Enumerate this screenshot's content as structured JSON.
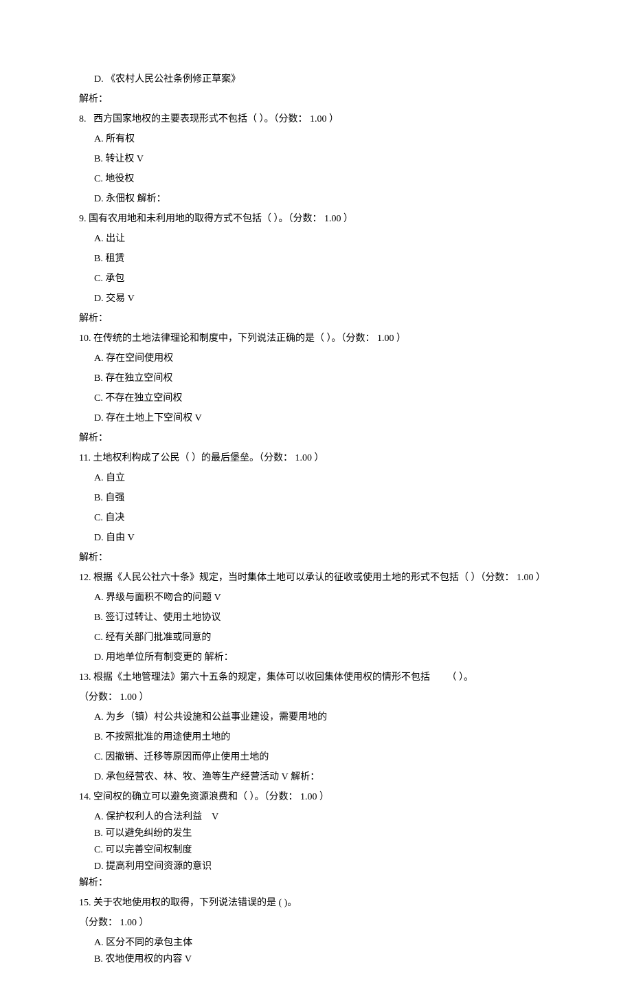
{
  "q7": {
    "d_letter": "D.",
    "d_text": "《农村人民公社条例修正草案》",
    "jx": "解析："
  },
  "q8": {
    "num": "8.",
    "stem": "西方国家地权的主要表现形式不包括（ ）。（分数： 1.00 ）",
    "a_letter": "A.",
    "a_text": "所有权",
    "b_letter": "B.",
    "b_text": "转让权",
    "b_mark": "V",
    "c_letter": "C.",
    "c_text": "地役权",
    "d_letter": "D.",
    "d_text": "永佃权 解析："
  },
  "q9": {
    "num": "9.",
    "stem": "国有农用地和未利用地的取得方式不包括（ ）。（分数： 1.00 ）",
    "a_letter": "A.",
    "a_text": "出让",
    "b_letter": "B.",
    "b_text": "租赁",
    "c_letter": "C.",
    "c_text": "承包",
    "d_letter": "D.",
    "d_text": "交易",
    "d_mark": "V",
    "jx": "解析："
  },
  "q10": {
    "num": "10.",
    "stem": "在传统的土地法律理论和制度中，下列说法正确的是（ ）。（分数： 1.00 ）",
    "a_letter": "A.",
    "a_text": "存在空间使用权",
    "b_letter": "B.",
    "b_text": "存在独立空间权",
    "c_letter": "C.",
    "c_text": "不存在独立空间权",
    "d_letter": "D.",
    "d_text": "存在土地上下空间权",
    "d_mark": "V",
    "jx": "解析："
  },
  "q11": {
    "num": "11.",
    "stem": "土地权利构成了公民（ ）的最后堡垒。（分数： 1.00 ）",
    "a_letter": "A.",
    "a_text": "自立",
    "b_letter": "B.",
    "b_text": "自强",
    "c_letter": "C.",
    "c_text": "自决",
    "d_letter": "D.",
    "d_text": "自由",
    "d_mark": "V",
    "jx": "解析："
  },
  "q12": {
    "num": "12.",
    "stem": "根据《人民公社六十条》规定，当时集体土地可以承认的征收或使用土地的形式不包括（ ）（分数： 1.00 ）",
    "a_letter": "A.",
    "a_text": "界级与面积不吻合的问题",
    "a_mark": "V",
    "b_letter": "B.",
    "b_text": "签订过转让、使用土地协议",
    "c_letter": "C.",
    "c_text": "经有关部门批准或同意的",
    "d_letter": "D.",
    "d_text": "用地单位所有制变更的 解析："
  },
  "q13": {
    "num": "13.",
    "stem1": "根据《土地管理法》第六十五条的规定，集体可以收回集体使用权的情形不包括",
    "stem2": "（ ）。",
    "score": "（分数： 1.00 ）",
    "a_letter": "A.",
    "a_text": "为乡（镇）村公共设施和公益事业建设，需要用地的",
    "b_letter": "B.",
    "b_text": "不按照批准的用途使用土地的",
    "c_letter": "C.",
    "c_text": "因撤销、迁移等原因而停止使用土地的",
    "d_letter": "D.",
    "d_text": "承包经营农、林、牧、渔等生产经营活动",
    "d_mark": "V",
    "d_tail": "解析："
  },
  "q14": {
    "num": "14.",
    "stem": "空间权的确立可以避免资源浪费和（ ）。（分数： 1.00 ）",
    "a_letter": "A.",
    "a_text": "保护权利人的合法利益",
    "a_mark": "V",
    "b_letter": "B.",
    "b_text": "可以避免纠纷的发生",
    "c_letter": "C.",
    "c_text": "可以完善空间权制度",
    "d_letter": "D.",
    "d_text": "提高利用空间资源的意识",
    "jx": "解析："
  },
  "q15": {
    "num": "15.",
    "stem": "关于农地使用权的取得，下列说法错误的是 ( )。",
    "score": "（分数： 1.00 ）",
    "a_letter": "A.",
    "a_text": "区分不同的承包主体",
    "b_letter": "B.",
    "b_text": "农地使用权的内容",
    "b_mark": "V"
  }
}
